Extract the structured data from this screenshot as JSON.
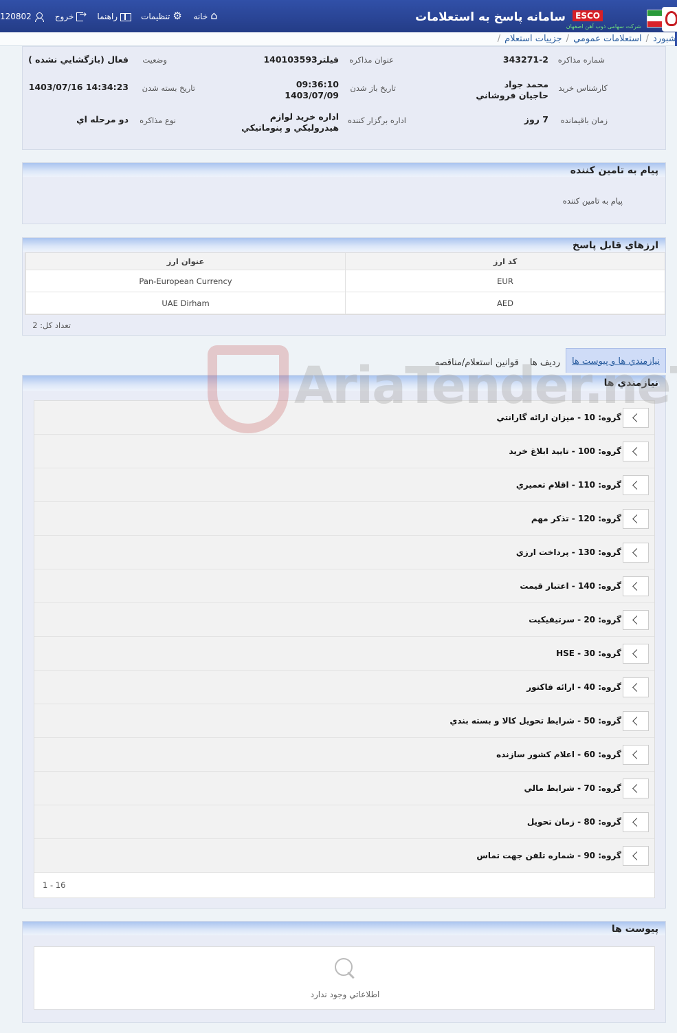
{
  "header": {
    "app_title": "سامانه پاسخ به استعلامات",
    "esco_label": "ESCO",
    "esco_sub": "شرکت سهامی ذوب آهن اصفهان",
    "nav": {
      "user_id": "120802",
      "exit": "خروج",
      "help": "راهنما",
      "settings": "تنظیمات",
      "home": "خانه"
    }
  },
  "breadcrumb": [
    "داشبورد",
    "استعلامات عمومي",
    "جزييات استعلام"
  ],
  "info": {
    "negotiation_number_label": "شماره مذاکره",
    "negotiation_number": "343271-2",
    "negotiation_title_label": "عنوان مذاکره",
    "negotiation_title": "فيلتر140103593",
    "status_label": "وضعيت",
    "status": "فعال (بازگشايي نشده )",
    "expert_label": "کارشناس خريد",
    "expert": "محمد جواد حاجيان فروشاني",
    "open_date_label": "تاريخ باز شدن",
    "open_time": "09:36:10",
    "open_date": "1403/07/09",
    "close_date_label": "تاريخ بسته شدن",
    "close_date": "1403/07/16 14:34:23",
    "remaining_label": "زمان باقيمانده",
    "remaining": "7 روز",
    "organizer_label": "اداره برگزار کننده",
    "organizer": "اداره خريد لوازم هيدروليکي و پنوماتيکي",
    "type_label": "نوع مذاکره",
    "type": "دو مرحله اي"
  },
  "message_panel": {
    "title": "پيام به تامين کننده",
    "text": "پيام به تامين کننده"
  },
  "currency_panel": {
    "title": "ارزهاي قابل پاسخ",
    "columns": [
      "کد ارز",
      "عنوان ارز"
    ],
    "rows": [
      [
        "EUR",
        "Pan-European Currency"
      ],
      [
        "AED",
        "UAE Dirham"
      ]
    ],
    "total": "تعداد کل: 2"
  },
  "tabs": [
    "نيازمندي ها و پيوست ها",
    "رديف ها",
    "قوانين استعلام/مناقصه"
  ],
  "requirements_panel": {
    "title": "نيازمندي ها",
    "items": [
      "گروه: 10 - ميزان ارائه گارانتي",
      "گروه: 100 - تاييد ابلاغ خريد",
      "گروه: 110 - اقلام تعميري",
      "گروه: 120 - تذکر مهم",
      "گروه: 130 - پرداخت ارزي",
      "گروه: 140 - اعتبار قيمت",
      "گروه: 20 - سرتيفيکيت",
      "گروه: 30 - HSE",
      "گروه: 40 - ارائه فاکتور",
      "گروه: 50 - شرايط تحويل کالا و بسته بندي",
      "گروه: 60 - اعلام کشور سازنده",
      "گروه: 70 - شرايط مالي",
      "گروه: 80 - زمان تحويل",
      "گروه: 90 - شماره تلفن جهت تماس"
    ],
    "pager": "1 - 16"
  },
  "attachments_panel": {
    "title": "پيوست ها",
    "empty": "اطلاعاتي وجود ندارد"
  },
  "watermark": "AriaTender.neT"
}
